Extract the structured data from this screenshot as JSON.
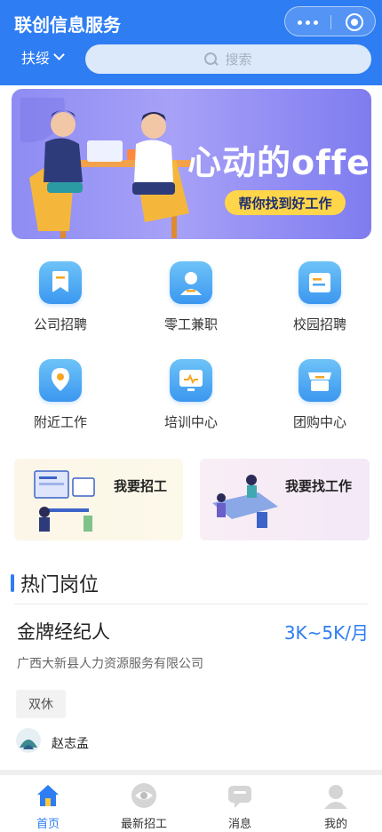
{
  "header": {
    "title": "联创信息服务",
    "city": "扶绥",
    "search_placeholder": "搜索"
  },
  "banner": {
    "heading": "心动的offer",
    "button": "帮你找到好工作"
  },
  "grid": [
    {
      "label": "公司招聘",
      "icon": "bookmark-icon"
    },
    {
      "label": "零工兼职",
      "icon": "person-icon"
    },
    {
      "label": "校园招聘",
      "icon": "document-icon"
    },
    {
      "label": "附近工作",
      "icon": "location-pin-icon"
    },
    {
      "label": "培训中心",
      "icon": "monitor-icon"
    },
    {
      "label": "团购中心",
      "icon": "store-icon"
    }
  ],
  "promos": {
    "hire": "我要招工",
    "find_job": "我要找工作"
  },
  "hot_jobs": {
    "section_title": "热门岗位",
    "jobs": [
      {
        "title": "金牌经纪人",
        "salary": "3K~5K/月",
        "company": "广西大新县人力资源服务有限公司",
        "tags": [
          "双休"
        ],
        "recruiter": "赵志孟"
      }
    ]
  },
  "tabbar": [
    {
      "label": "首页",
      "icon": "home-icon",
      "active": true
    },
    {
      "label": "最新招工",
      "icon": "eye-icon",
      "active": false
    },
    {
      "label": "消息",
      "icon": "chat-bubble-icon",
      "active": false
    },
    {
      "label": "我的",
      "icon": "user-icon",
      "active": false
    }
  ],
  "colors": {
    "primary": "#2e7df2",
    "banner_accent": "#ffd54a"
  }
}
